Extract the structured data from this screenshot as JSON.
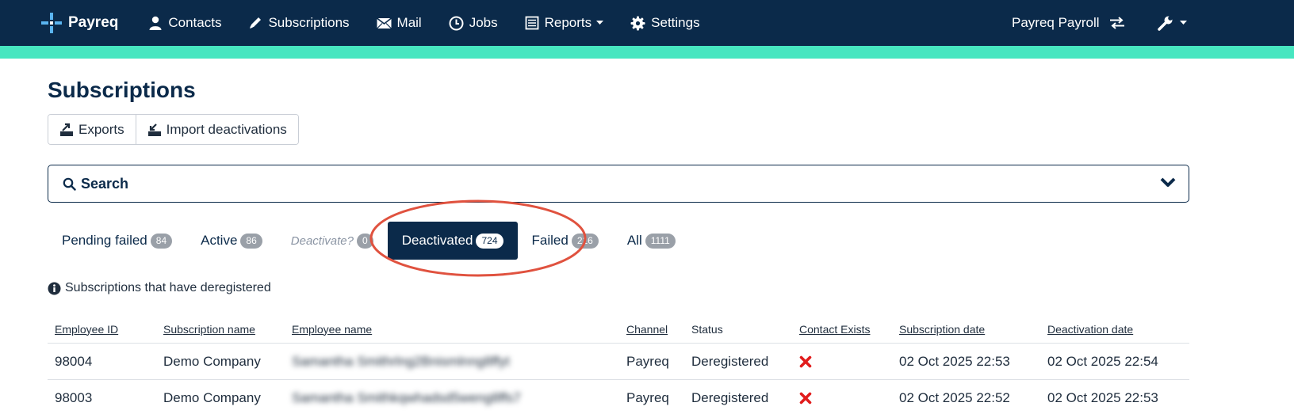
{
  "nav": {
    "brand": "Payreq",
    "items": [
      {
        "label": "Contacts",
        "icon": "user-icon"
      },
      {
        "label": "Subscriptions",
        "icon": "pencil-icon"
      },
      {
        "label": "Mail",
        "icon": "envelope-icon"
      },
      {
        "label": "Jobs",
        "icon": "clock-icon"
      },
      {
        "label": "Reports",
        "icon": "report-icon"
      },
      {
        "label": "Settings",
        "icon": "gear-icon"
      }
    ],
    "account": "Payreq Payroll",
    "colors": {
      "navbar": "#0b2a4a",
      "accent_bar": "#47e6c0"
    }
  },
  "page": {
    "title": "Subscriptions",
    "buttons": {
      "exports": "Exports",
      "import": "Import deactivations"
    },
    "search": {
      "label": "Search"
    },
    "tabs": [
      {
        "label": "Pending failed",
        "count": "84"
      },
      {
        "label": "Active",
        "count": "86"
      },
      {
        "label": "Deactivate?",
        "count": "0"
      },
      {
        "label": "Deactivated",
        "count": "724",
        "active": true
      },
      {
        "label": "Failed",
        "count": "216"
      },
      {
        "label": "All",
        "count": "1111"
      }
    ],
    "info_text": "Subscriptions that have deregistered"
  },
  "table": {
    "columns": [
      "Employee ID",
      "Subscription name",
      "Employee name",
      "Channel",
      "Status",
      "Contact Exists",
      "Subscription date",
      "Deactivation date"
    ],
    "rows": [
      {
        "employee_id": "98004",
        "subscription_name": "Demo Company",
        "employee_name": "Samantha Smithrlng2Bnismlnng8ffyt",
        "channel": "Payreq",
        "status": "Deregistered",
        "contact_exists": "no",
        "subscription_date": "02 Oct 2025 22:53",
        "deactivation_date": "02 Oct 2025 22:54"
      },
      {
        "employee_id": "98003",
        "subscription_name": "Demo Company",
        "employee_name": "Samantha Smithkqwhadsd5weng8ffs7",
        "channel": "Payreq",
        "status": "Deregistered",
        "contact_exists": "no",
        "subscription_date": "02 Oct 2025 22:52",
        "deactivation_date": "02 Oct 2025 22:53"
      }
    ]
  }
}
